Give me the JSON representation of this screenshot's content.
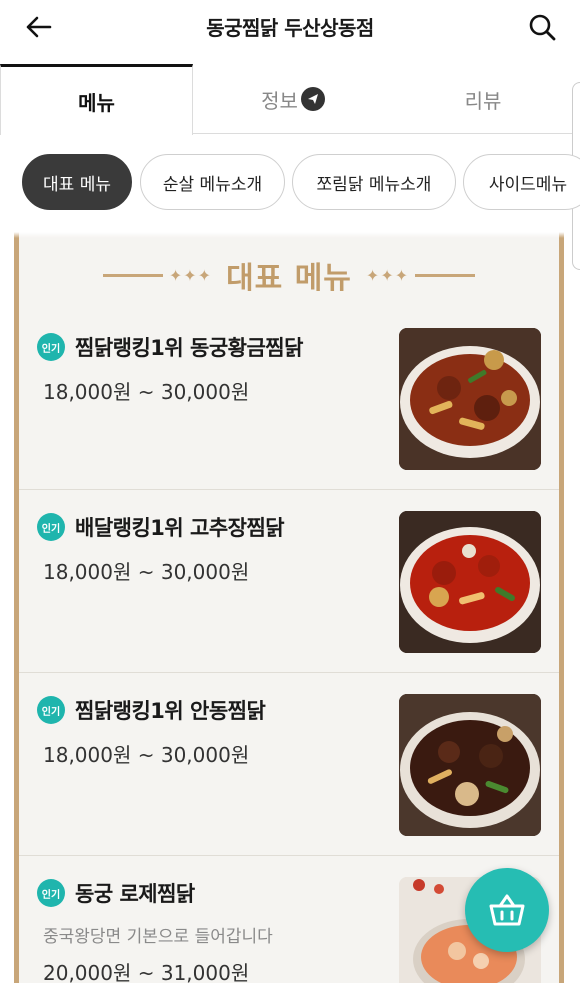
{
  "header": {
    "title": "동궁찜닭 두산상동점",
    "back_icon": "arrow-left-icon",
    "search_icon": "search-icon"
  },
  "tabs": [
    {
      "label": "메뉴",
      "active": true
    },
    {
      "label": "정보",
      "active": false,
      "icon": "send-icon"
    },
    {
      "label": "리뷰",
      "active": false
    }
  ],
  "chips": [
    {
      "label": "대표 메뉴",
      "active": true
    },
    {
      "label": "순살 메뉴소개",
      "active": false
    },
    {
      "label": "쪼림닭 메뉴소개",
      "active": false
    },
    {
      "label": "사이드메뉴",
      "active": false
    }
  ],
  "section": {
    "title": "대표 메뉴",
    "ornament": "✦✦✦"
  },
  "menu_items": [
    {
      "badge": "인기",
      "name": "찜닭랭킹1위 동궁황금찜닭",
      "desc": "",
      "price": "18,000원 ~ 30,000원"
    },
    {
      "badge": "인기",
      "name": "배달랭킹1위 고추장찜닭",
      "desc": "",
      "price": "18,000원 ~ 30,000원"
    },
    {
      "badge": "인기",
      "name": "찜닭랭킹1위 안동찜닭",
      "desc": "",
      "price": "18,000원 ~ 30,000원"
    },
    {
      "badge": "인기",
      "name": "동궁 로제찜닭",
      "desc": "중국왕당면 기본으로 들어갑니다",
      "price": "20,000원 ~ 31,000원"
    }
  ],
  "cart_icon": "basket-icon",
  "colors": {
    "accent": "#26bdb3",
    "badge": "#1fb5ad",
    "gold": "#c8a679",
    "chip_active": "#3a3a3a"
  }
}
